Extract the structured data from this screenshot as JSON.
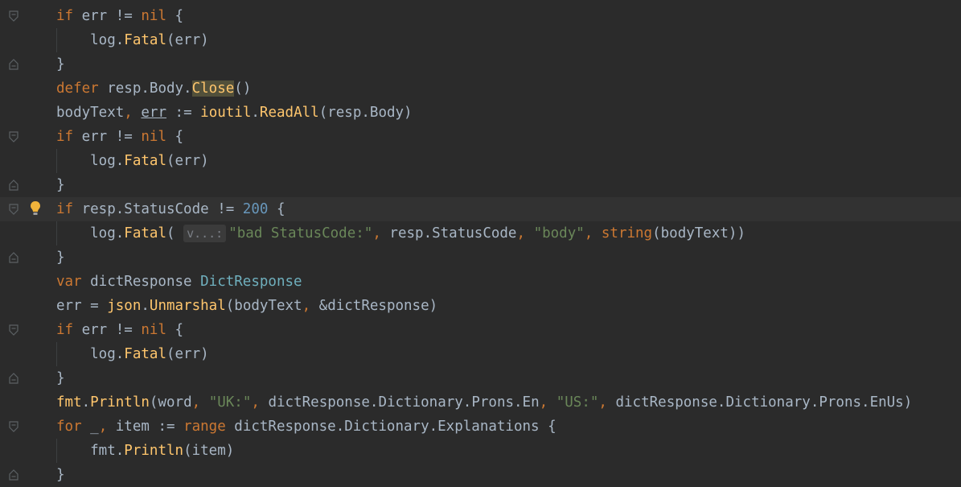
{
  "editor": {
    "language": "Go",
    "inlay_hint": "v...:",
    "lines": [
      {
        "fold": "down",
        "tokens": [
          [
            "kw",
            "if"
          ],
          [
            "p",
            " err != "
          ],
          [
            "kw",
            "nil"
          ],
          [
            "p",
            " {"
          ]
        ]
      },
      {
        "fold": "none",
        "tokens": [
          [
            "p",
            "    log."
          ],
          [
            "fn",
            "Fatal"
          ],
          [
            "p",
            "(err)"
          ]
        ]
      },
      {
        "fold": "up",
        "tokens": [
          [
            "p",
            "}"
          ]
        ]
      },
      {
        "fold": "none",
        "tokens": [
          [
            "kw",
            "defer"
          ],
          [
            "p",
            " resp.Body."
          ],
          [
            "sel",
            "Close"
          ],
          [
            "p",
            "()"
          ]
        ]
      },
      {
        "fold": "none",
        "tokens": [
          [
            "p",
            "bodyText"
          ],
          [
            "kw",
            ","
          ],
          [
            "p",
            " "
          ],
          [
            "ul",
            "err"
          ],
          [
            "p",
            " := "
          ],
          [
            "pkg",
            "ioutil"
          ],
          [
            "p",
            "."
          ],
          [
            "fn",
            "ReadAll"
          ],
          [
            "p",
            "(resp.Body)"
          ]
        ]
      },
      {
        "fold": "down",
        "tokens": [
          [
            "kw",
            "if"
          ],
          [
            "p",
            " err != "
          ],
          [
            "kw",
            "nil"
          ],
          [
            "p",
            " {"
          ]
        ]
      },
      {
        "fold": "none",
        "tokens": [
          [
            "p",
            "    log."
          ],
          [
            "fn",
            "Fatal"
          ],
          [
            "p",
            "(err)"
          ]
        ]
      },
      {
        "fold": "up",
        "tokens": [
          [
            "p",
            "}"
          ]
        ]
      },
      {
        "fold": "down",
        "current": true,
        "bulb": true,
        "tokens": [
          [
            "kw",
            "if"
          ],
          [
            "p",
            " resp.StatusCode != "
          ],
          [
            "num",
            "200"
          ],
          [
            "p",
            " {"
          ]
        ]
      },
      {
        "fold": "none",
        "tokens": [
          [
            "p",
            "    log."
          ],
          [
            "fn",
            "Fatal"
          ],
          [
            "p",
            "( "
          ],
          [
            "hint",
            "v...:"
          ],
          [
            "str",
            "\"bad StatusCode:\""
          ],
          [
            "kw",
            ","
          ],
          [
            "p",
            " resp.StatusCode"
          ],
          [
            "kw",
            ","
          ],
          [
            "p",
            " "
          ],
          [
            "str",
            "\"body\""
          ],
          [
            "kw",
            ","
          ],
          [
            "p",
            " "
          ],
          [
            "kw",
            "string"
          ],
          [
            "p",
            "(bodyText))"
          ]
        ]
      },
      {
        "fold": "up",
        "tokens": [
          [
            "p",
            "}"
          ]
        ]
      },
      {
        "fold": "none",
        "tokens": [
          [
            "kw",
            "var"
          ],
          [
            "p",
            " dictResponse "
          ],
          [
            "typ",
            "DictResponse"
          ]
        ]
      },
      {
        "fold": "none",
        "tokens": [
          [
            "p",
            "err = "
          ],
          [
            "pkg",
            "json"
          ],
          [
            "p",
            "."
          ],
          [
            "fn",
            "Unmarshal"
          ],
          [
            "p",
            "(bodyText"
          ],
          [
            "kw",
            ","
          ],
          [
            "p",
            " &dictResponse)"
          ]
        ]
      },
      {
        "fold": "down",
        "tokens": [
          [
            "kw",
            "if"
          ],
          [
            "p",
            " err != "
          ],
          [
            "kw",
            "nil"
          ],
          [
            "p",
            " {"
          ]
        ]
      },
      {
        "fold": "none",
        "tokens": [
          [
            "p",
            "    log."
          ],
          [
            "fn",
            "Fatal"
          ],
          [
            "p",
            "(err)"
          ]
        ]
      },
      {
        "fold": "up",
        "tokens": [
          [
            "p",
            "}"
          ]
        ]
      },
      {
        "fold": "none",
        "tokens": [
          [
            "pkg",
            "fmt"
          ],
          [
            "p",
            "."
          ],
          [
            "fn",
            "Println"
          ],
          [
            "p",
            "(word"
          ],
          [
            "kw",
            ","
          ],
          [
            "p",
            " "
          ],
          [
            "str",
            "\"UK:\""
          ],
          [
            "kw",
            ","
          ],
          [
            "p",
            " dictResponse.Dictionary.Prons.En"
          ],
          [
            "kw",
            ","
          ],
          [
            "p",
            " "
          ],
          [
            "str",
            "\"US:\""
          ],
          [
            "kw",
            ","
          ],
          [
            "p",
            " dictResponse.Dictionary.Prons.EnUs)"
          ]
        ]
      },
      {
        "fold": "down",
        "tokens": [
          [
            "kw",
            "for"
          ],
          [
            "p",
            " _"
          ],
          [
            "kw",
            ","
          ],
          [
            "p",
            " item := "
          ],
          [
            "kw",
            "range"
          ],
          [
            "p",
            " dictResponse.Dictionary.Explanations {"
          ]
        ]
      },
      {
        "fold": "none",
        "tokens": [
          [
            "p",
            "    fmt."
          ],
          [
            "fn",
            "Println"
          ],
          [
            "p",
            "(item)"
          ]
        ]
      },
      {
        "fold": "up",
        "tokens": [
          [
            "p",
            "}"
          ]
        ]
      }
    ]
  }
}
